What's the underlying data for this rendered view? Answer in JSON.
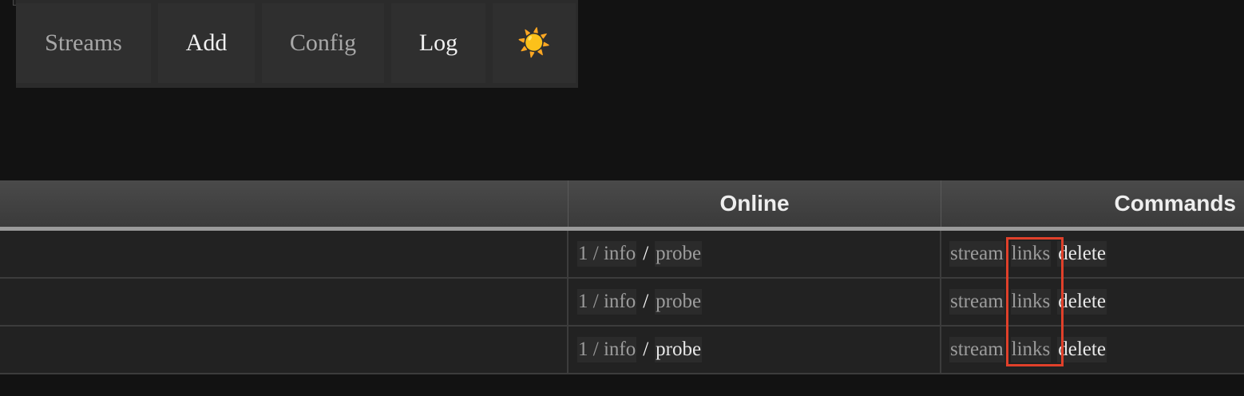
{
  "nav": {
    "streams": "Streams",
    "add": "Add",
    "config": "Config",
    "log": "Log",
    "theme_icon": "☀️"
  },
  "table": {
    "headers": {
      "name": "",
      "online": "Online",
      "commands": "Commands"
    },
    "rows": [
      {
        "online_count": "1 / info",
        "online_sep": "/",
        "probe": "probe",
        "cmd_stream": "stream",
        "cmd_links": "links",
        "cmd_delete": "delete"
      },
      {
        "online_count": "1 / info",
        "online_sep": "/",
        "probe": "probe",
        "cmd_stream": "stream",
        "cmd_links": "links",
        "cmd_delete": "delete"
      },
      {
        "online_count": "1 / info",
        "online_sep": "/",
        "probe": "probe",
        "cmd_stream": "stream",
        "cmd_links": "links",
        "cmd_delete": "delete"
      }
    ]
  },
  "colors": {
    "background": "#121212",
    "highlight": "#e0402a"
  }
}
